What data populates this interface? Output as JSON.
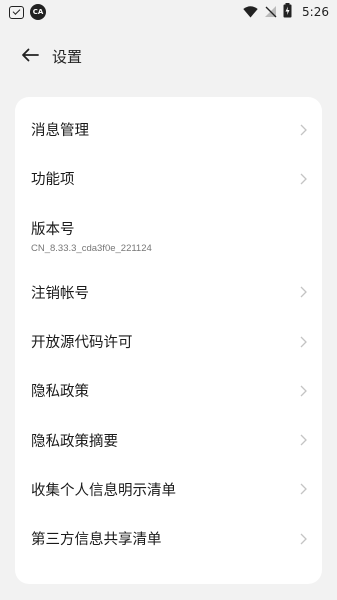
{
  "status_bar": {
    "left_icons": [
      "inbox-icon",
      "app-circle-icon"
    ],
    "app_circle_text": "CA",
    "right_icons": [
      "wifi-icon",
      "no-signal-icon",
      "battery-charging-icon"
    ],
    "time": "5:26"
  },
  "header": {
    "back_icon": "arrow-left-icon",
    "title": "设置"
  },
  "settings": {
    "items": [
      {
        "label": "消息管理",
        "has_chevron": true
      },
      {
        "label": "功能项",
        "has_chevron": true
      },
      {
        "label": "版本号",
        "sub": "CN_8.33.3_cda3f0e_221124",
        "has_chevron": false
      },
      {
        "label": "注销帐号",
        "has_chevron": true
      },
      {
        "label": "开放源代码许可",
        "has_chevron": true
      },
      {
        "label": "隐私政策",
        "has_chevron": true
      },
      {
        "label": "隐私政策摘要",
        "has_chevron": true
      },
      {
        "label": "收集个人信息明示清单",
        "has_chevron": true
      },
      {
        "label": "第三方信息共享清单",
        "has_chevron": true
      }
    ]
  },
  "colors": {
    "background": "#f2f2f2",
    "card": "#ffffff",
    "chevron": "#c4c4c4",
    "subtext": "#777777"
  }
}
